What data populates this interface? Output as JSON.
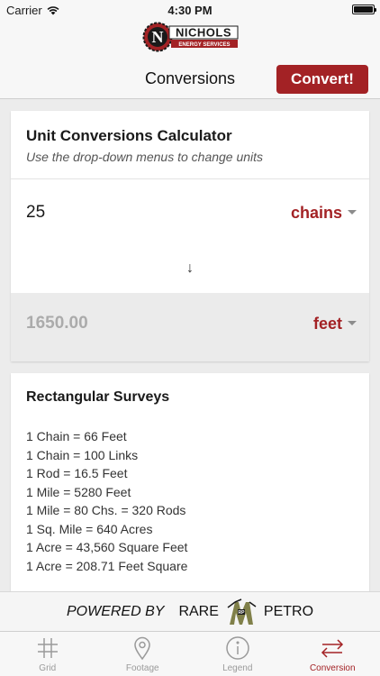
{
  "status_bar": {
    "carrier": "Carrier",
    "time": "4:30 PM"
  },
  "nav": {
    "logo_text": "NICHOLS",
    "logo_subtext": "ENERGY SERVICES",
    "title": "Conversions",
    "convert_label": "Convert!"
  },
  "calculator": {
    "title": "Unit Conversions Calculator",
    "subtitle": "Use the drop-down menus to change units",
    "input_value": "25",
    "input_unit": "chains",
    "arrow": "↓",
    "output_value": "1650.00",
    "output_unit": "feet"
  },
  "surveys": {
    "title": "Rectangular Surveys",
    "items": [
      "1 Chain = 66 Feet",
      "1 Chain = 100 Links",
      "1 Rod = 16.5 Feet",
      "1 Mile = 5280 Feet",
      "1 Mile = 80 Chs. = 320 Rods",
      "1 Sq. Mile = 640 Acres",
      "1 Acre = 43,560 Square Feet",
      "1 Acre = 208.71 Feet Square"
    ]
  },
  "powered_by": {
    "label": "POWERED BY",
    "left_word": "RARE",
    "right_word": "PETRO"
  },
  "tabs": [
    {
      "label": "Grid",
      "icon": "grid-icon",
      "active": false
    },
    {
      "label": "Footage",
      "icon": "map-pin-icon",
      "active": false
    },
    {
      "label": "Legend",
      "icon": "info-icon",
      "active": false
    },
    {
      "label": "Conversion",
      "icon": "swap-arrows-icon",
      "active": true
    }
  ],
  "colors": {
    "accent": "#a32225",
    "inactive": "#9a9a9a"
  }
}
